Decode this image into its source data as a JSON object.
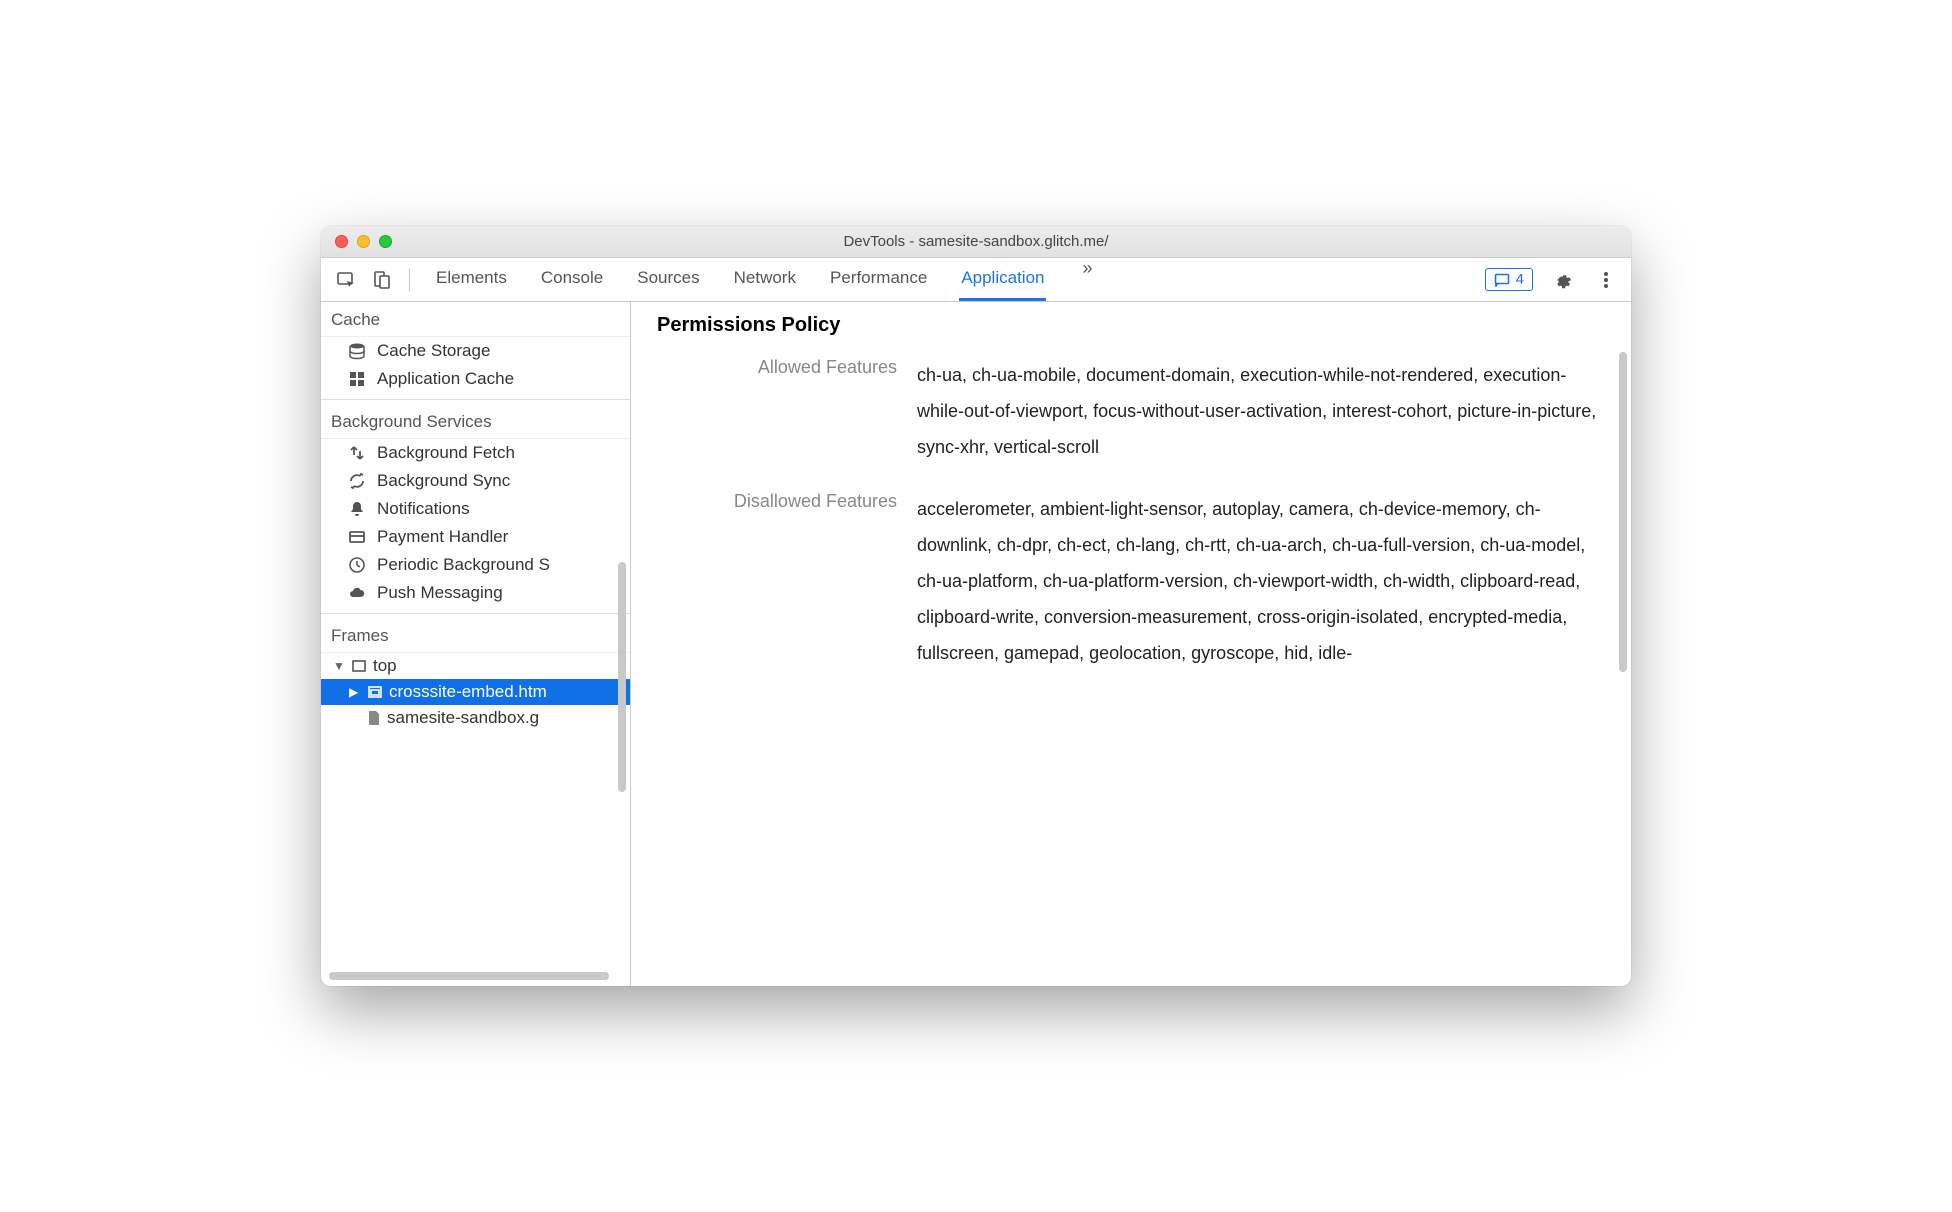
{
  "window": {
    "title": "DevTools - samesite-sandbox.glitch.me/"
  },
  "tabs": {
    "items": [
      "Elements",
      "Console",
      "Sources",
      "Network",
      "Performance",
      "Application"
    ],
    "active": "Application",
    "more": "»"
  },
  "toolbar": {
    "issues_count": "4"
  },
  "sidebar": {
    "sections": [
      {
        "header": "Cache",
        "items": [
          {
            "icon": "cache-storage-icon",
            "label": "Cache Storage"
          },
          {
            "icon": "app-cache-icon",
            "label": "Application Cache"
          }
        ]
      },
      {
        "header": "Background Services",
        "items": [
          {
            "icon": "bg-fetch-icon",
            "label": "Background Fetch"
          },
          {
            "icon": "bg-sync-icon",
            "label": "Background Sync"
          },
          {
            "icon": "bell-icon",
            "label": "Notifications"
          },
          {
            "icon": "card-icon",
            "label": "Payment Handler"
          },
          {
            "icon": "clock-icon",
            "label": "Periodic Background S"
          },
          {
            "icon": "cloud-icon",
            "label": "Push Messaging"
          }
        ]
      },
      {
        "header": "Frames",
        "tree": [
          {
            "level": 0,
            "arrow": "▼",
            "icon": "frame-icon",
            "label": "top",
            "selected": false
          },
          {
            "level": 1,
            "arrow": "▶",
            "icon": "iframe-icon",
            "label": "crosssite-embed.htm",
            "selected": true
          },
          {
            "level": 1,
            "arrow": "",
            "icon": "doc-icon",
            "label": "samesite-sandbox.g",
            "selected": false
          }
        ]
      }
    ]
  },
  "main": {
    "heading": "Permissions Policy",
    "rows": [
      {
        "label": "Allowed Features",
        "value": "ch-ua, ch-ua-mobile, document-domain, execution-while-not-rendered, execution-while-out-of-viewport, focus-without-user-activation, interest-cohort, picture-in-picture, sync-xhr, vertical-scroll"
      },
      {
        "label": "Disallowed Features",
        "value": "accelerometer, ambient-light-sensor, autoplay, camera, ch-device-memory, ch-downlink, ch-dpr, ch-ect, ch-lang, ch-rtt, ch-ua-arch, ch-ua-full-version, ch-ua-model, ch-ua-platform, ch-ua-platform-version, ch-viewport-width, ch-width, clipboard-read, clipboard-write, conversion-measurement, cross-origin-isolated, encrypted-media, fullscreen, gamepad, geolocation, gyroscope, hid, idle-"
      }
    ]
  }
}
